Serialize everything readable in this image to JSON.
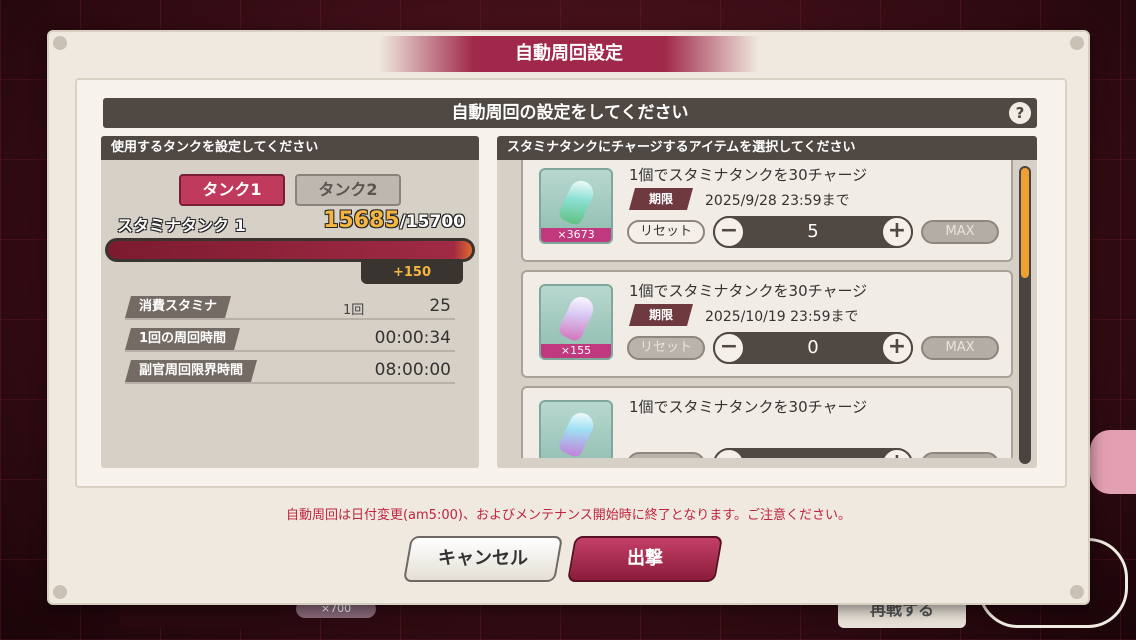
{
  "modal": {
    "title": "自動周回設定",
    "header": "自動周回の設定をしてください",
    "help_label": "?"
  },
  "left": {
    "header": "使用するタンクを設定してください",
    "tabs": [
      "タンク1",
      "タンク2"
    ],
    "active_tab": 0,
    "stamina_label": "スタミナタンク 1",
    "stamina_current": "15685",
    "stamina_max": "/15700",
    "stamina_fill_fraction": 0.999,
    "stamina_add": "+150",
    "stats": [
      {
        "label": "消費スタミナ",
        "unit": "1回",
        "value": "25"
      },
      {
        "label": "1回の周回時間",
        "unit": "",
        "value": "00:00:34"
      },
      {
        "label": "副官周回限界時間",
        "unit": "",
        "value": "08:00:00"
      }
    ]
  },
  "right": {
    "header": "スタミナタンクにチャージするアイテムを選択してください",
    "items": [
      {
        "desc": "1個でスタミナタンクを30チャージ",
        "deadline_tag": "期限",
        "deadline": "2025/9/28 23:59まで",
        "count": "×3673",
        "reset": "リセット",
        "value": "5",
        "max": "MAX"
      },
      {
        "desc": "1個でスタミナタンクを30チャージ",
        "deadline_tag": "期限",
        "deadline": "2025/10/19 23:59まで",
        "count": "×155",
        "reset": "リセット",
        "value": "0",
        "max": "MAX"
      },
      {
        "desc": "1個でスタミナタンクを30チャージ",
        "deadline_tag": "",
        "deadline": "",
        "count": "",
        "reset": "",
        "value": "",
        "max": ""
      }
    ]
  },
  "notice": "自動周回は日付変更(am5:00)、およびメンテナンス開始時に終了となります。ご注意ください。",
  "buttons": {
    "cancel": "キャンセル",
    "sortie": "出撃"
  },
  "background": {
    "counter": "×700",
    "pill": "再戦する"
  },
  "colors": {
    "accent": "#c03a5e",
    "header_dark": "#4f4843",
    "notice": "#c0243e",
    "stamina_number": "#f4b640"
  }
}
